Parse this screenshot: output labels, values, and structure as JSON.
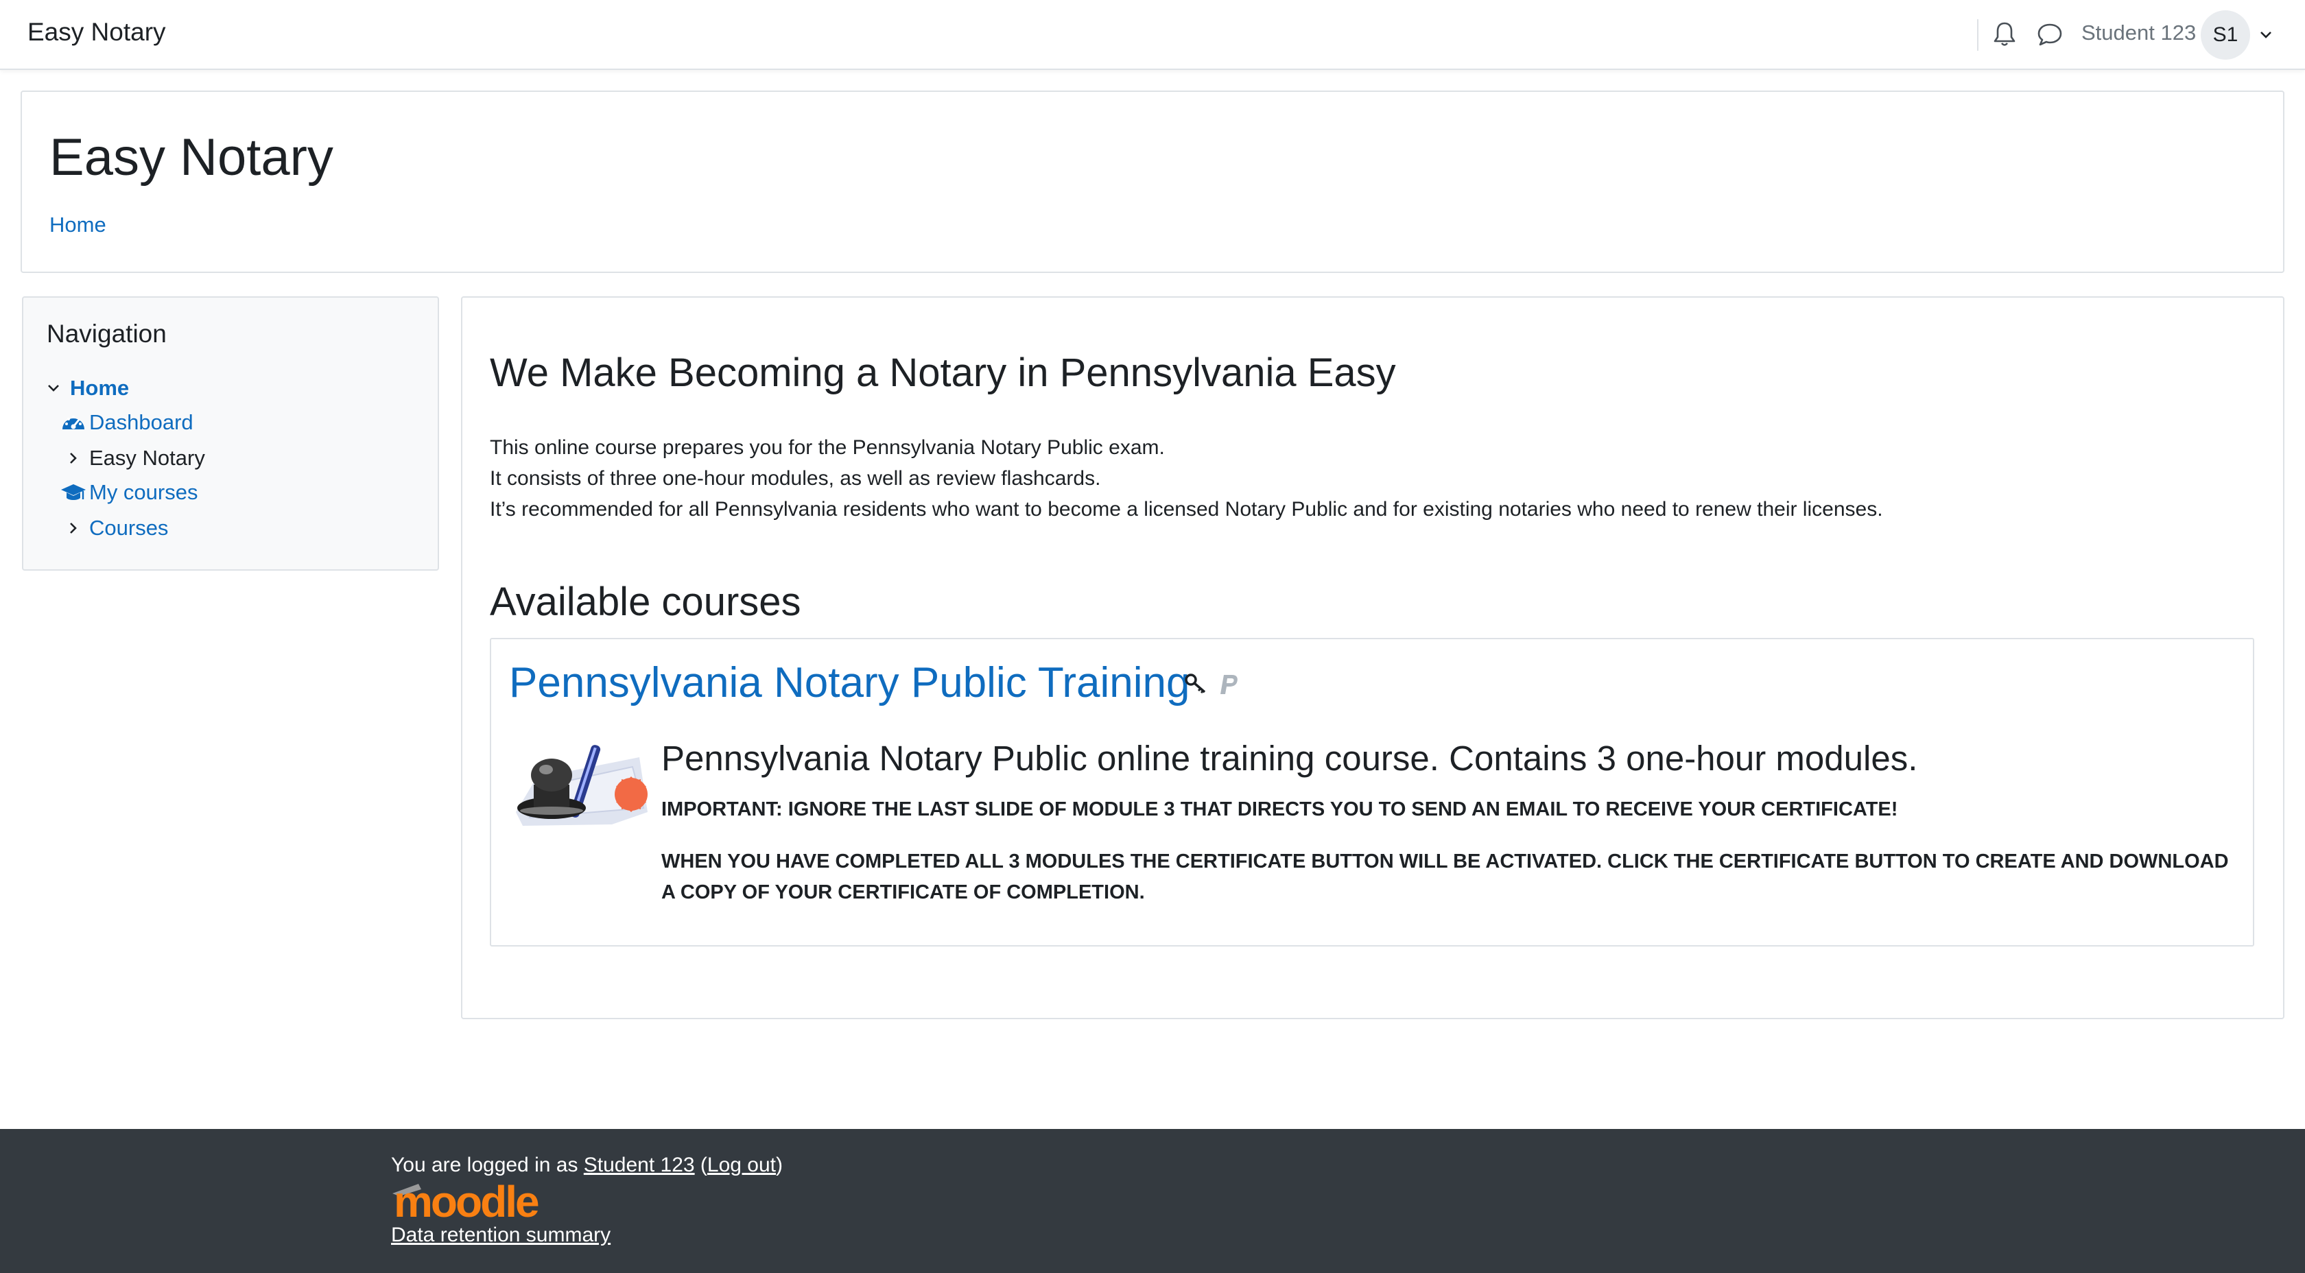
{
  "navbar": {
    "brand": "Easy Notary",
    "user_name": "Student 123",
    "avatar_initials": "S1"
  },
  "page_header": {
    "title": "Easy Notary",
    "breadcrumb": "Home"
  },
  "navigation_block": {
    "title": "Navigation",
    "items": [
      {
        "label": "Home",
        "icon": "chevron-down-icon"
      },
      {
        "label": "Dashboard",
        "icon": "dashboard-gauge-icon"
      },
      {
        "label": "Easy Notary",
        "icon": "chevron-right-icon"
      },
      {
        "label": "My courses",
        "icon": "graduation-cap-icon"
      },
      {
        "label": "Courses",
        "icon": "chevron-right-icon"
      }
    ]
  },
  "site_summary": {
    "heading": "We Make Becoming a Notary in Pennsylvania Easy",
    "lines": [
      "This online course prepares you for the Pennsylvania Notary Public exam.",
      "It consists of three one-hour modules, as well as review flashcards.",
      "It’s recommended for all Pennsylvania residents who want to become a licensed Notary Public and for existing notaries who need to renew their licenses."
    ]
  },
  "available_courses": {
    "heading": "Available courses",
    "course": {
      "title": "Pennsylvania Notary Public Training",
      "enrolment_icons": [
        "key-icon",
        "paypal-icon"
      ],
      "summary_title": "Pennsylvania Notary Public online training course. Contains 3 one-hour modules.",
      "important_note": "IMPORTANT: IGNORE THE LAST SLIDE OF MODULE 3 THAT DIRECTS YOU TO SEND AN EMAIL TO RECEIVE YOUR CERTIFICATE!",
      "completion_note": "WHEN YOU HAVE COMPLETED ALL 3 MODULES THE CERTIFICATE BUTTON WILL BE ACTIVATED. CLICK THE CERTIFICATE BUTTON TO CREATE AND DOWNLOAD A COPY OF YOUR CERTIFICATE OF COMPLETION."
    }
  },
  "footer": {
    "logged_in_prefix": "You are logged in as ",
    "user_link": "Student 123",
    "logout_link": "Log out",
    "open_paren": " (",
    "close_paren": ")",
    "logo_text": "moodle",
    "data_retention": "Data retention summary"
  },
  "colors": {
    "link": "#0f6cbf",
    "footer_bg": "#343a40",
    "moodle_orange": "#f98012"
  }
}
